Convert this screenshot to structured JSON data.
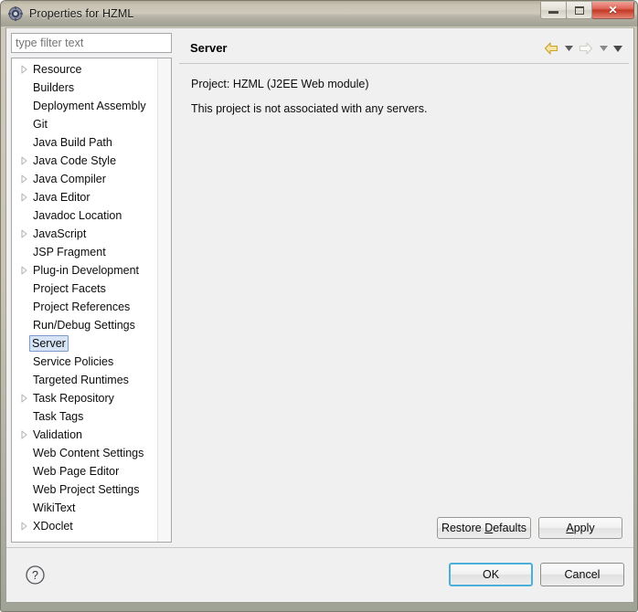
{
  "window": {
    "title": "Properties for HZML",
    "icon": "properties-gear-icon",
    "minimize_label": "",
    "maximize_label": "",
    "close_label": "✕"
  },
  "filter": {
    "value": "",
    "placeholder": "type filter text"
  },
  "tree": {
    "items": [
      {
        "label": "Resource",
        "expandable": true,
        "selected": false
      },
      {
        "label": "Builders",
        "expandable": false,
        "selected": false
      },
      {
        "label": "Deployment Assembly",
        "expandable": false,
        "selected": false
      },
      {
        "label": "Git",
        "expandable": false,
        "selected": false
      },
      {
        "label": "Java Build Path",
        "expandable": false,
        "selected": false
      },
      {
        "label": "Java Code Style",
        "expandable": true,
        "selected": false
      },
      {
        "label": "Java Compiler",
        "expandable": true,
        "selected": false
      },
      {
        "label": "Java Editor",
        "expandable": true,
        "selected": false
      },
      {
        "label": "Javadoc Location",
        "expandable": false,
        "selected": false
      },
      {
        "label": "JavaScript",
        "expandable": true,
        "selected": false
      },
      {
        "label": "JSP Fragment",
        "expandable": false,
        "selected": false
      },
      {
        "label": "Plug-in Development",
        "expandable": true,
        "selected": false
      },
      {
        "label": "Project Facets",
        "expandable": false,
        "selected": false
      },
      {
        "label": "Project References",
        "expandable": false,
        "selected": false
      },
      {
        "label": "Run/Debug Settings",
        "expandable": false,
        "selected": false
      },
      {
        "label": "Server",
        "expandable": false,
        "selected": true
      },
      {
        "label": "Service Policies",
        "expandable": false,
        "selected": false
      },
      {
        "label": "Targeted Runtimes",
        "expandable": false,
        "selected": false
      },
      {
        "label": "Task Repository",
        "expandable": true,
        "selected": false
      },
      {
        "label": "Task Tags",
        "expandable": false,
        "selected": false
      },
      {
        "label": "Validation",
        "expandable": true,
        "selected": false
      },
      {
        "label": "Web Content Settings",
        "expandable": false,
        "selected": false
      },
      {
        "label": "Web Page Editor",
        "expandable": false,
        "selected": false
      },
      {
        "label": "Web Project Settings",
        "expandable": false,
        "selected": false
      },
      {
        "label": "WikiText",
        "expandable": false,
        "selected": false
      },
      {
        "label": "XDoclet",
        "expandable": true,
        "selected": false
      }
    ]
  },
  "page": {
    "title": "Server",
    "lines": [
      "Project: HZML (J2EE Web module)",
      "This project is not associated with any servers."
    ],
    "nav": {
      "back_icon": "back-arrow-icon",
      "back_menu_icon": "chevron-down-icon",
      "forward_icon": "forward-arrow-icon",
      "forward_menu_icon": "chevron-down-icon",
      "overflow_menu_icon": "chevron-down-icon"
    }
  },
  "buttons": {
    "restore_defaults": "Restore Defaults",
    "restore_defaults_mnemonic": "D",
    "apply": "Apply",
    "apply_mnemonic": "A",
    "ok": "OK",
    "cancel": "Cancel"
  },
  "help": {
    "icon": "help-question-icon",
    "glyph": "?"
  },
  "colors": {
    "titlebar_top": "#cfcabb",
    "titlebar_bottom": "#9fa395",
    "close_button": "#c33a26",
    "dialog_bg": "#f0f0f0",
    "selection_bg": "#d6e4f5",
    "selection_border": "#7a9cc6",
    "default_button_focus": "#4ab0d8",
    "nav_arrow_enabled": "#e8c968",
    "nav_arrow_disabled": "#d8d8d0"
  }
}
